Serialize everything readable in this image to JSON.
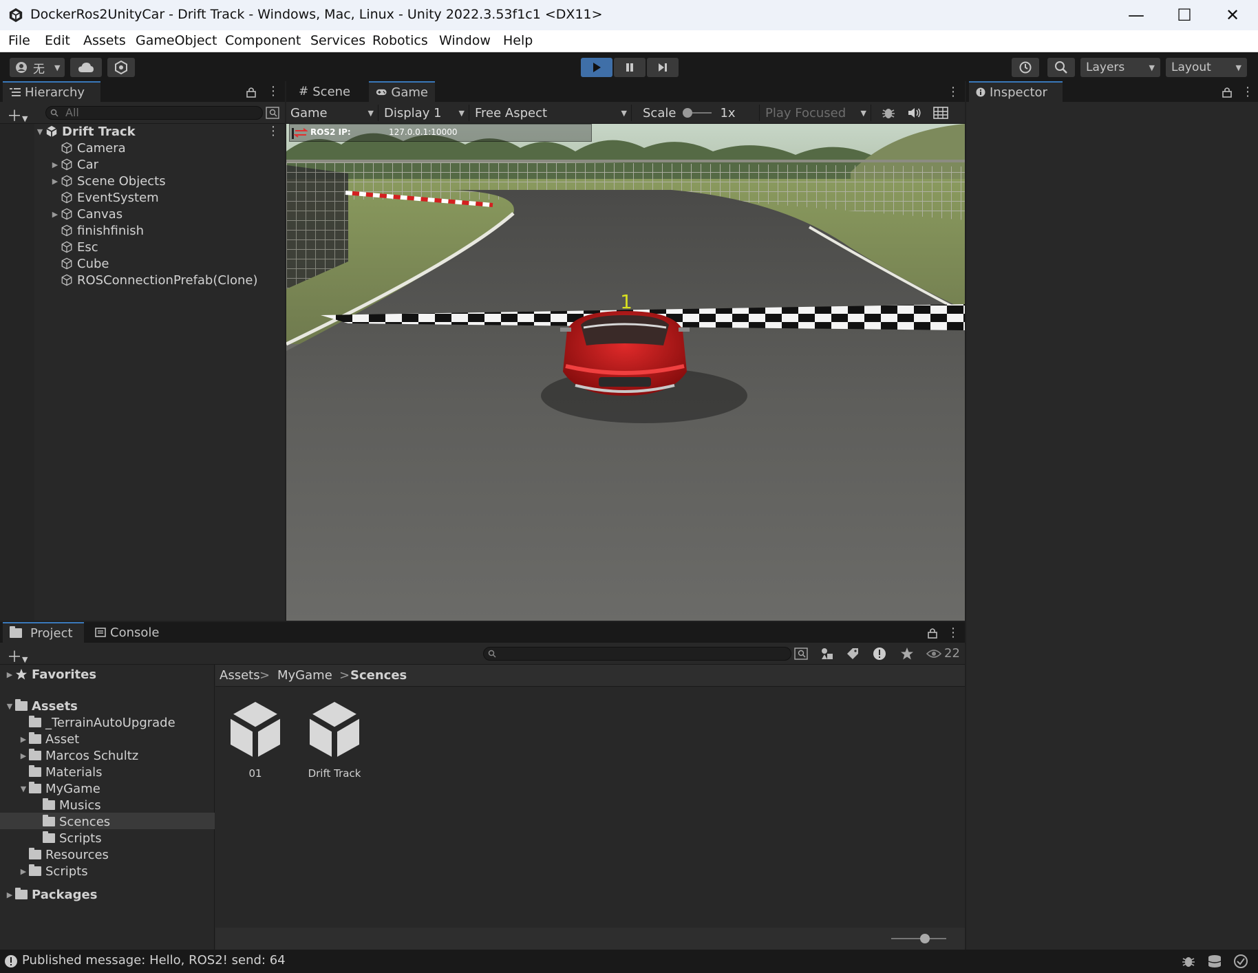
{
  "window": {
    "title": "DockerRos2UnityCar - Drift Track - Windows, Mac, Linux - Unity 2022.3.53f1c1 <DX11>",
    "minimize_glyph": "—",
    "maximize_glyph": "☐",
    "close_glyph": "✕"
  },
  "menu": [
    "File",
    "Edit",
    "Assets",
    "GameObject",
    "Component",
    "Services",
    "Robotics",
    "Window",
    "Help"
  ],
  "toolbar": {
    "account_label": "无",
    "layers_label": "Layers",
    "layout_label": "Layout"
  },
  "hierarchy": {
    "tab_label": "Hierarchy",
    "search_placeholder": "All",
    "scene_name": "Drift Track",
    "items": [
      "Camera",
      "Car",
      "Scene Objects",
      "EventSystem",
      "Canvas",
      "finishfinish",
      "Esc",
      "Cube",
      "ROSConnectionPrefab(Clone)"
    ]
  },
  "scene_tabs": {
    "scene_label": "Scene",
    "game_label": "Game"
  },
  "game_toolbar": {
    "view_mode": "Game",
    "display": "Display 1",
    "aspect": "Free Aspect",
    "scale_label": "Scale",
    "scale_value": "1x",
    "play_mode": "Play Focused"
  },
  "game_view": {
    "ros_label": "ROS2 IP:",
    "ros_ip": "127.0.0.1:10000",
    "lap_number": "1"
  },
  "inspector": {
    "tab_label": "Inspector"
  },
  "bottom_tabs": {
    "project_label": "Project",
    "console_label": "Console",
    "hidden_count": "22"
  },
  "project": {
    "favorites_label": "Favorites",
    "assets_label": "Assets",
    "packages_label": "Packages",
    "folders": [
      "_TerrainAutoUpgrade",
      "Asset",
      "Marcos Schultz",
      "Materials",
      "MyGame",
      "Musics",
      "Scences",
      "Scripts",
      "Resources",
      "Scripts"
    ],
    "breadcrumb": [
      "Assets",
      "MyGame",
      "Scences"
    ],
    "breadcrumb_sep": ">",
    "assets": [
      "01",
      "Drift Track"
    ],
    "selected_folder": "Scences"
  },
  "status": {
    "message": "Published message: Hello, ROS2! send: 64"
  },
  "colors": {
    "accent": "#3a79bb",
    "play_active": "#3f6fa8",
    "panel": "#282828",
    "dark": "#191919"
  }
}
